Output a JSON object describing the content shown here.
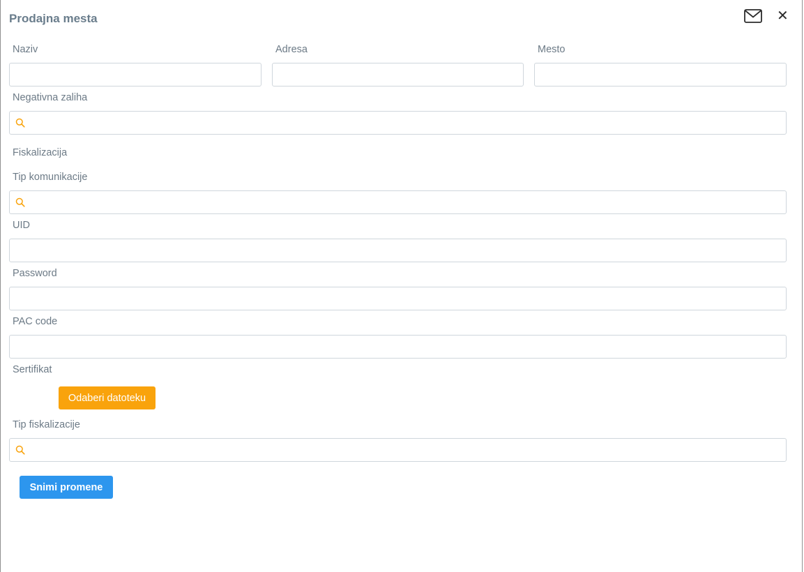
{
  "header": {
    "title": "Prodajna mesta"
  },
  "fields": {
    "naziv_label": "Naziv",
    "naziv_value": "",
    "adresa_label": "Adresa",
    "adresa_value": "",
    "mesto_label": "Mesto",
    "mesto_value": "",
    "negativna_zaliha_label": "Negativna zaliha",
    "negativna_zaliha_value": "",
    "fiskalizacija_heading": "Fiskalizacija",
    "tip_komunikacije_label": "Tip komunikacije",
    "tip_komunikacije_value": "",
    "uid_label": "UID",
    "uid_value": "",
    "password_label": "Password",
    "password_value": "",
    "pac_code_label": "PAC code",
    "pac_code_value": "",
    "sertifikat_label": "Sertifikat",
    "tip_fiskalizacije_label": "Tip fiskalizacije",
    "tip_fiskalizacije_value": ""
  },
  "buttons": {
    "choose_file_label": "Odaberi datoteku",
    "save_label": "Snimi promene"
  },
  "icons": {
    "mail": "mail-icon",
    "close": "close-icon",
    "search": "search-icon"
  },
  "colors": {
    "accent_orange": "#f9a30c",
    "primary_blue": "#2d96ee",
    "title_text": "#6a7d8c",
    "label_text": "#6c7a86"
  }
}
